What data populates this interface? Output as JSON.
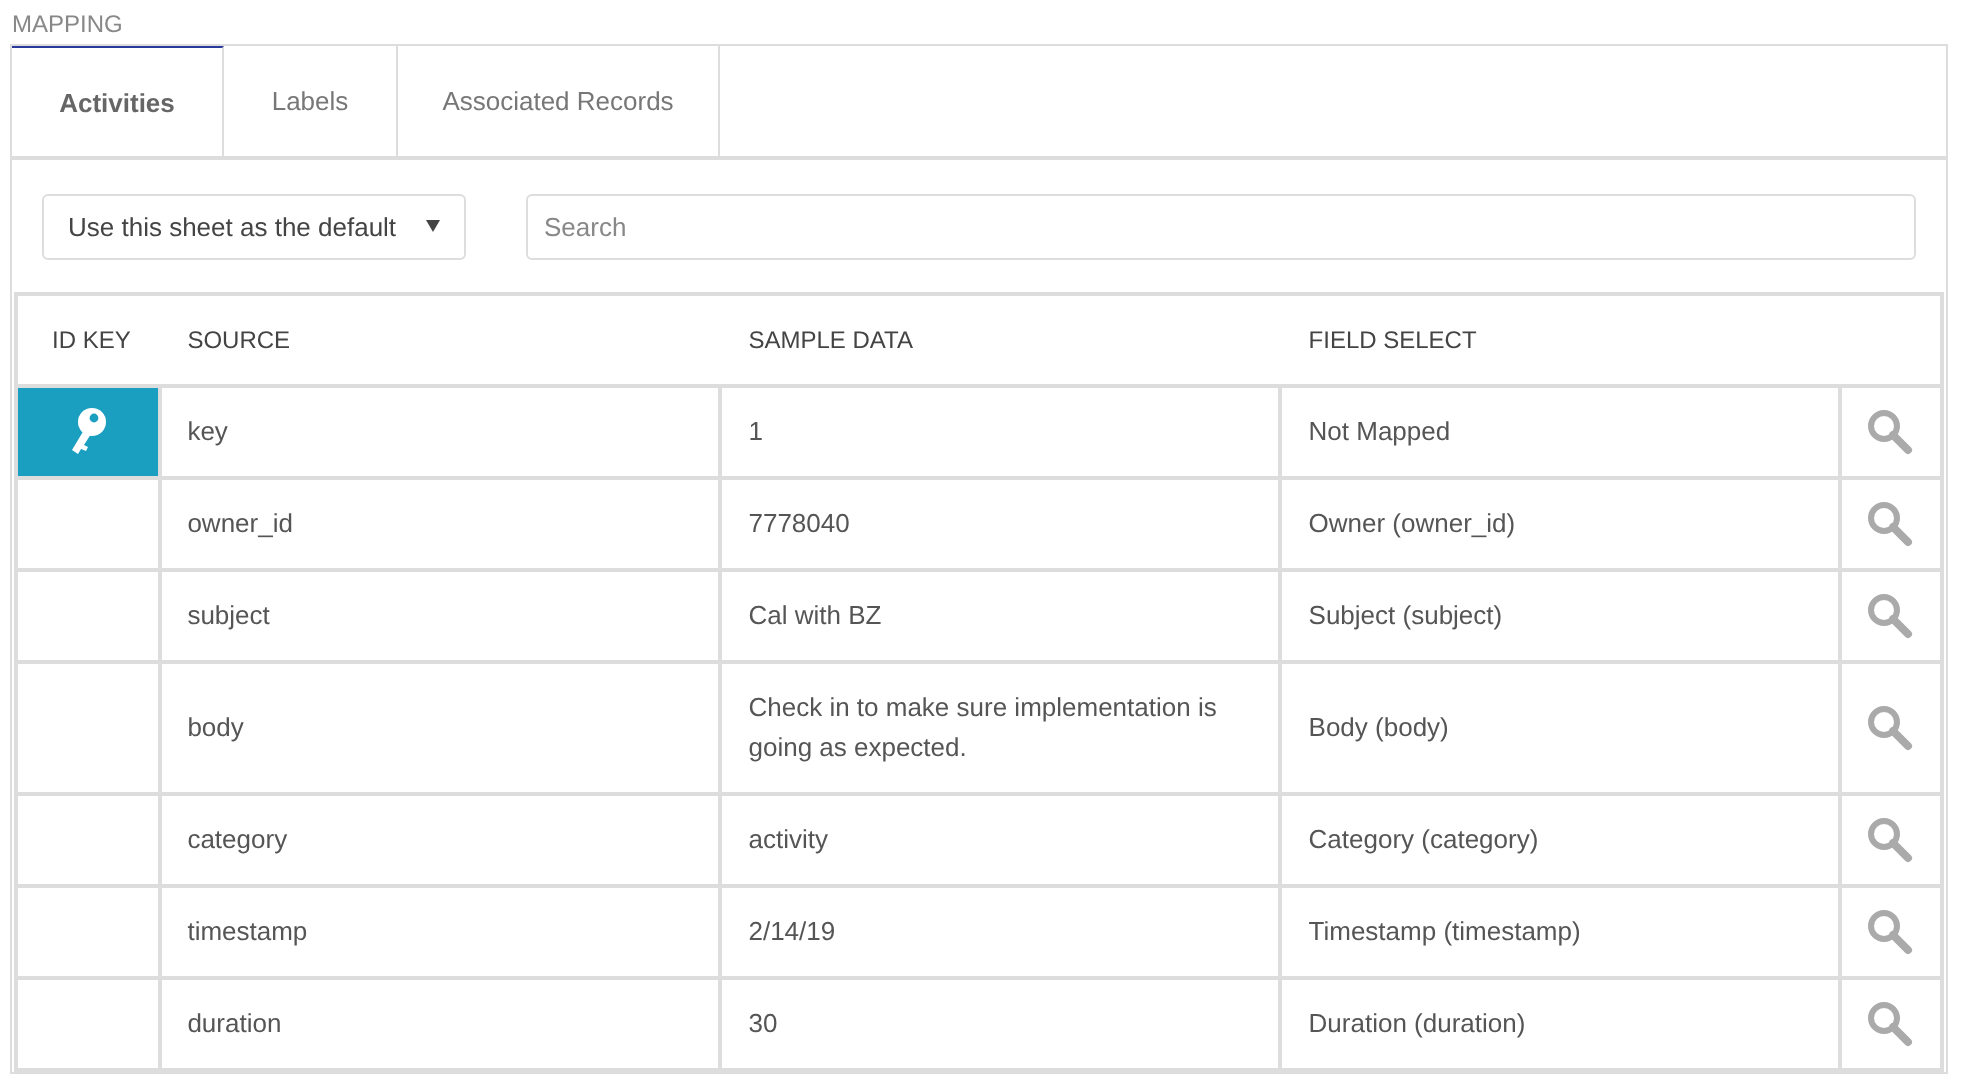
{
  "section_title": "MAPPING",
  "tabs": [
    {
      "label": "Activities",
      "selected": true
    },
    {
      "label": "Labels",
      "selected": false
    },
    {
      "label": "Associated Records",
      "selected": false
    }
  ],
  "sheet_select": {
    "value": "Use this sheet as the default"
  },
  "search": {
    "placeholder": "Search"
  },
  "table": {
    "columns": [
      "ID KEY",
      "SOURCE",
      "SAMPLE DATA",
      "FIELD SELECT"
    ],
    "rows": [
      {
        "id_key": true,
        "source": "key",
        "sample": "1",
        "field": "Not Mapped"
      },
      {
        "id_key": false,
        "source": "owner_id",
        "sample": "7778040",
        "field": "Owner (owner_id)"
      },
      {
        "id_key": false,
        "source": "subject",
        "sample": "Cal with BZ",
        "field": "Subject (subject)"
      },
      {
        "id_key": false,
        "source": "body",
        "sample": "Check in to make sure implementation is going as expected.",
        "field": "Body (body)"
      },
      {
        "id_key": false,
        "source": "category",
        "sample": "activity",
        "field": "Category (category)"
      },
      {
        "id_key": false,
        "source": "timestamp",
        "sample": "2/14/19",
        "field": "Timestamp (timestamp)"
      },
      {
        "id_key": false,
        "source": "duration",
        "sample": "30",
        "field": "Duration (duration)"
      }
    ]
  }
}
